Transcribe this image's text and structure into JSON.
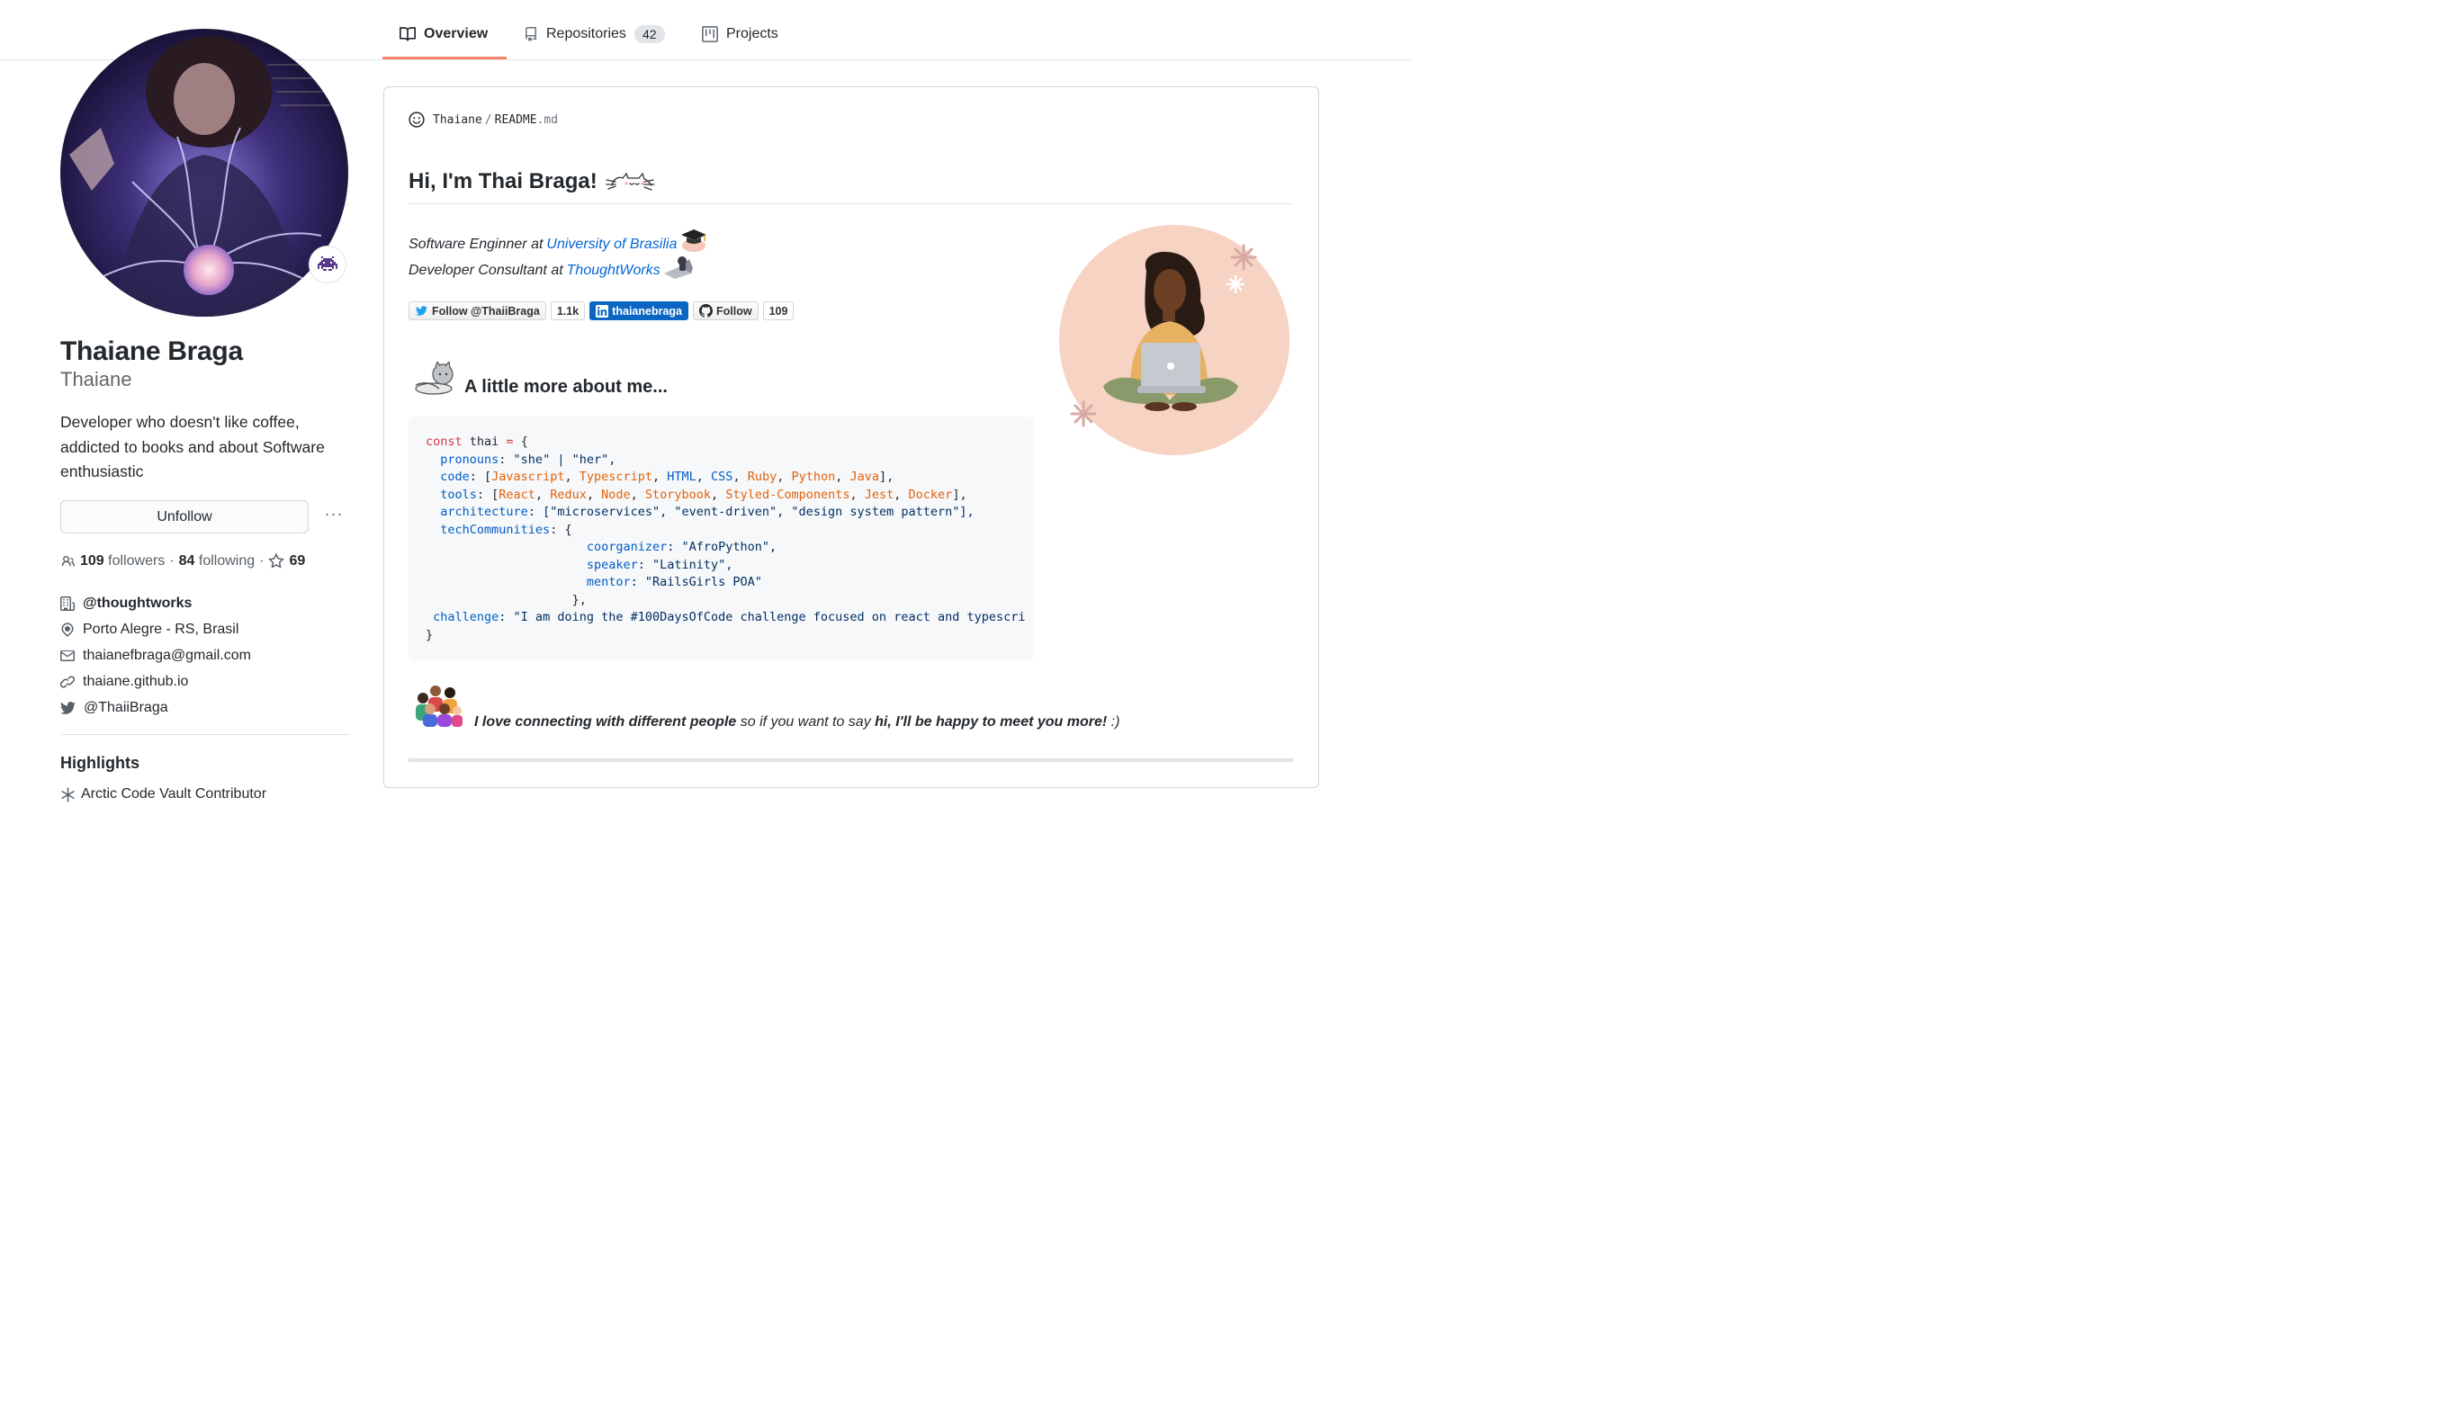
{
  "tabs": [
    {
      "label": "Overview",
      "icon": "book-icon",
      "active": true
    },
    {
      "label": "Repositories",
      "icon": "repo-icon",
      "count": "42"
    },
    {
      "label": "Projects",
      "icon": "project-icon"
    }
  ],
  "profile": {
    "fullname": "Thaiane Braga",
    "login": "Thaiane",
    "bio": "Developer who doesn't like coffee, addicted to books and about Software enthusiastic",
    "unfollow_label": "Unfollow",
    "more_label": "···",
    "followers_count": "109",
    "followers_label": "followers",
    "following_count": "84",
    "following_label": "following",
    "stars_count": "69",
    "company": "@thoughtworks",
    "location": "Porto Alegre - RS, Brasil",
    "email": "thaianefbraga@gmail.com",
    "website": "thaiane.github.io",
    "twitter": "@ThaiiBraga"
  },
  "highlights": {
    "title": "Highlights",
    "items": [
      "Arctic Code Vault Contributor"
    ]
  },
  "readme": {
    "owner": "Thaiane",
    "separator": "/",
    "file_base": "README",
    "file_ext": ".md",
    "heading": "Hi, I'm Thai Braga!",
    "role1_prefix": "Software Enginner at",
    "role1_link": "University of Brasilia",
    "role2_prefix": "Developer Consultant at",
    "role2_link": "ThoughtWorks",
    "badges": {
      "twitter_follow": "Follow @ThaiiBraga",
      "twitter_count": "1.1k",
      "linkedin": "thaianebraga",
      "github_follow": "Follow",
      "github_count": "109"
    },
    "about_heading": "A little more about me...",
    "closing_bold1": "I love connecting with different people",
    "closing_mid": " so if you want to say ",
    "closing_bold2": "hi, I'll be happy to meet you more!",
    "closing_end": " :)"
  },
  "code": {
    "l1_kw": "const",
    "l1_rest": " thai ",
    "l1_eq": "=",
    "l1_end": " {",
    "l2_key": "pronouns",
    "l2_val": ": \"she\" | \"her\",",
    "l3_key": "code",
    "l3_items": [
      "Javascript",
      "Typescript",
      "HTML",
      "CSS",
      "Ruby",
      "Python",
      "Java"
    ],
    "l4_key": "tools",
    "l4_items": [
      "React",
      "Redux",
      "Node",
      "Storybook",
      "Styled-Components",
      "Jest",
      "Docker"
    ],
    "l5_key": "architecture",
    "l5_val": ": [\"microservices\", \"event-driven\", \"design system pattern\"],",
    "l6_key": "techCommunities",
    "l6_val": ": {",
    "l7_key": "coorganizer",
    "l7_val": ": \"AfroPython\",",
    "l8_key": "speaker",
    "l8_val": ": \"Latinity\",",
    "l9_key": "mentor",
    "l9_val": ": \"RailsGirls POA\"",
    "l10": "},",
    "l11_key": "challenge",
    "l11_val": ": \"I am doing the #100DaysOfCode challenge focused on react and typescri",
    "l12": "}"
  },
  "colors": {
    "accent_underline": "#f9826c",
    "link": "#0366d6",
    "linkedin": "#0a66c2"
  }
}
